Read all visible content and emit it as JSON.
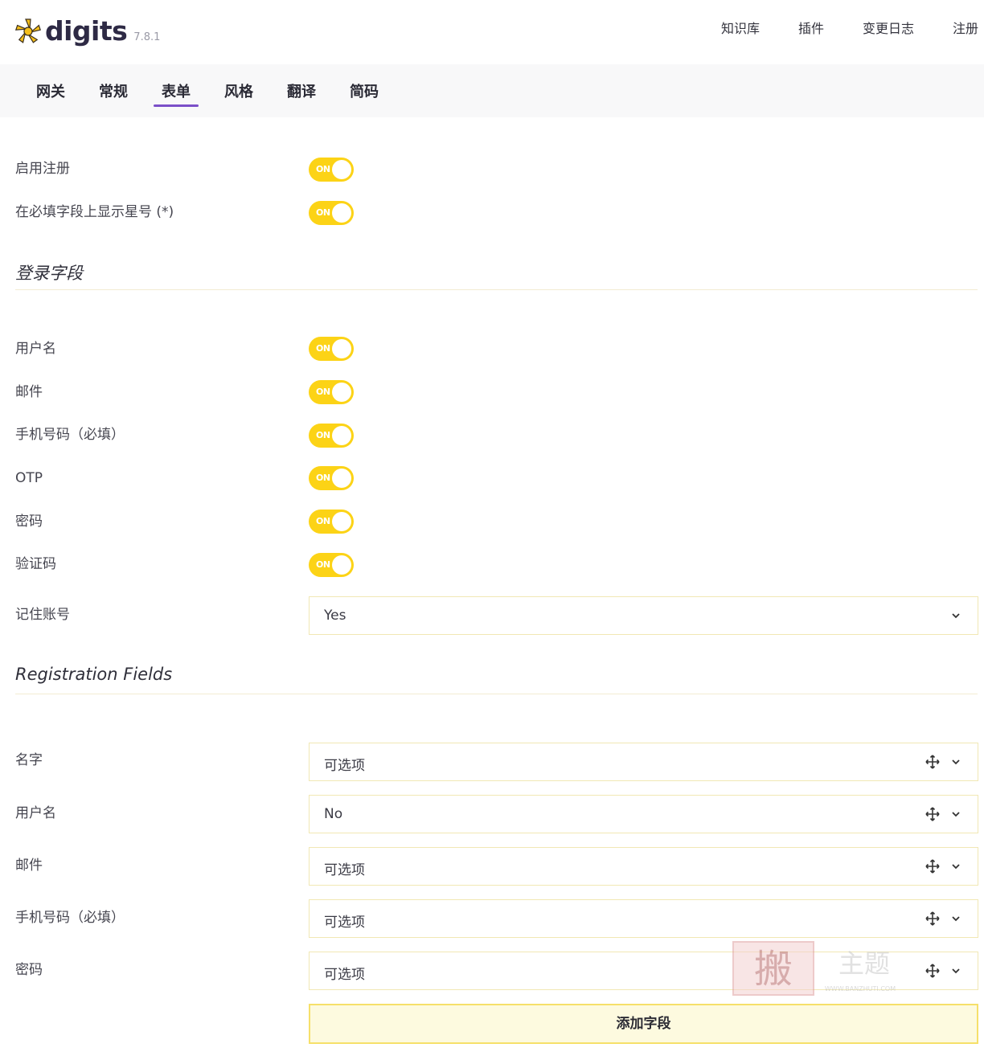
{
  "brand": {
    "name": "digits",
    "version": "7.8.1"
  },
  "topnav": [
    "知识库",
    "插件",
    "变更日志",
    "注册"
  ],
  "tabs": [
    {
      "label": "网关",
      "active": false
    },
    {
      "label": "常规",
      "active": false
    },
    {
      "label": "表单",
      "active": true
    },
    {
      "label": "风格",
      "active": false
    },
    {
      "label": "翻译",
      "active": false
    },
    {
      "label": "简码",
      "active": false
    }
  ],
  "general": {
    "enable_registration": {
      "label": "启用注册",
      "toggle": "ON"
    },
    "show_asterisk": {
      "label": "在必填字段上显示星号 (*)",
      "toggle": "ON"
    }
  },
  "login_fields": {
    "title": "登录字段",
    "username": {
      "label": "用户名",
      "toggle": "ON"
    },
    "email": {
      "label": "邮件",
      "toggle": "ON"
    },
    "phone": {
      "label": "手机号码（必填）",
      "toggle": "ON"
    },
    "otp": {
      "label": "OTP",
      "toggle": "ON"
    },
    "password": {
      "label": "密码",
      "toggle": "ON"
    },
    "captcha": {
      "label": "验证码",
      "toggle": "ON"
    },
    "remember_me": {
      "label": "记住账号",
      "value": "Yes"
    }
  },
  "registration_fields": {
    "title": "Registration Fields",
    "name": {
      "label": "名字",
      "value": "可选项"
    },
    "username": {
      "label": "用户名",
      "value": "No"
    },
    "email": {
      "label": "邮件",
      "value": "可选项"
    },
    "phone": {
      "label": "手机号码（必填）",
      "value": "可选项"
    },
    "password": {
      "label": "密码",
      "value": "可选项"
    },
    "add_field_label": "添加字段"
  },
  "watermark": {
    "text": "搬主题",
    "url_text": "WWW.BANZHUTI.COM"
  },
  "colors": {
    "accent": "#fcd316",
    "tab_underline": "#7b4fc8",
    "button_bg": "#fdfadf"
  }
}
